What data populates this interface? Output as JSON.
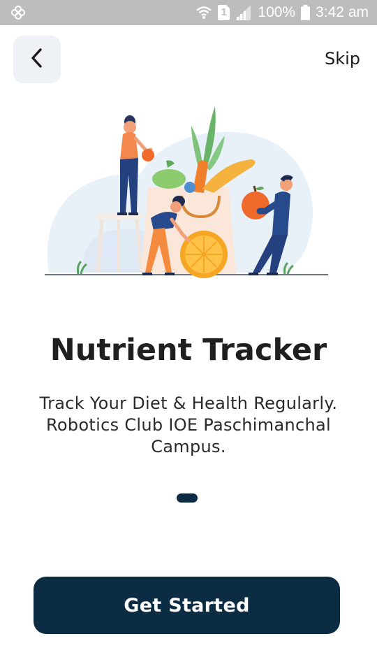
{
  "status_bar": {
    "battery_percent": "100%",
    "time": "3:42 am",
    "sim_slot": "1",
    "left_icon": "pinwheel-icon",
    "icons": [
      "wifi-icon",
      "sim-icon",
      "signal-icon",
      "battery-icon"
    ]
  },
  "nav": {
    "back_icon": "chevron-left-icon",
    "skip_label": "Skip"
  },
  "illustration": {
    "name": "people-with-groceries-illustration"
  },
  "main": {
    "title": "Nutrient Tracker",
    "subtitle_lines": [
      "Track Your Diet & Health Regularly.",
      "Robotics Club IOE Paschimanchal",
      "Campus."
    ]
  },
  "pager": {
    "active_index": 0,
    "count": 1
  },
  "cta": {
    "label": "Get Started"
  },
  "colors": {
    "primary": "#0b2c42",
    "status_bar": "#bdbdbd",
    "back_button_bg": "#eef2f6"
  }
}
